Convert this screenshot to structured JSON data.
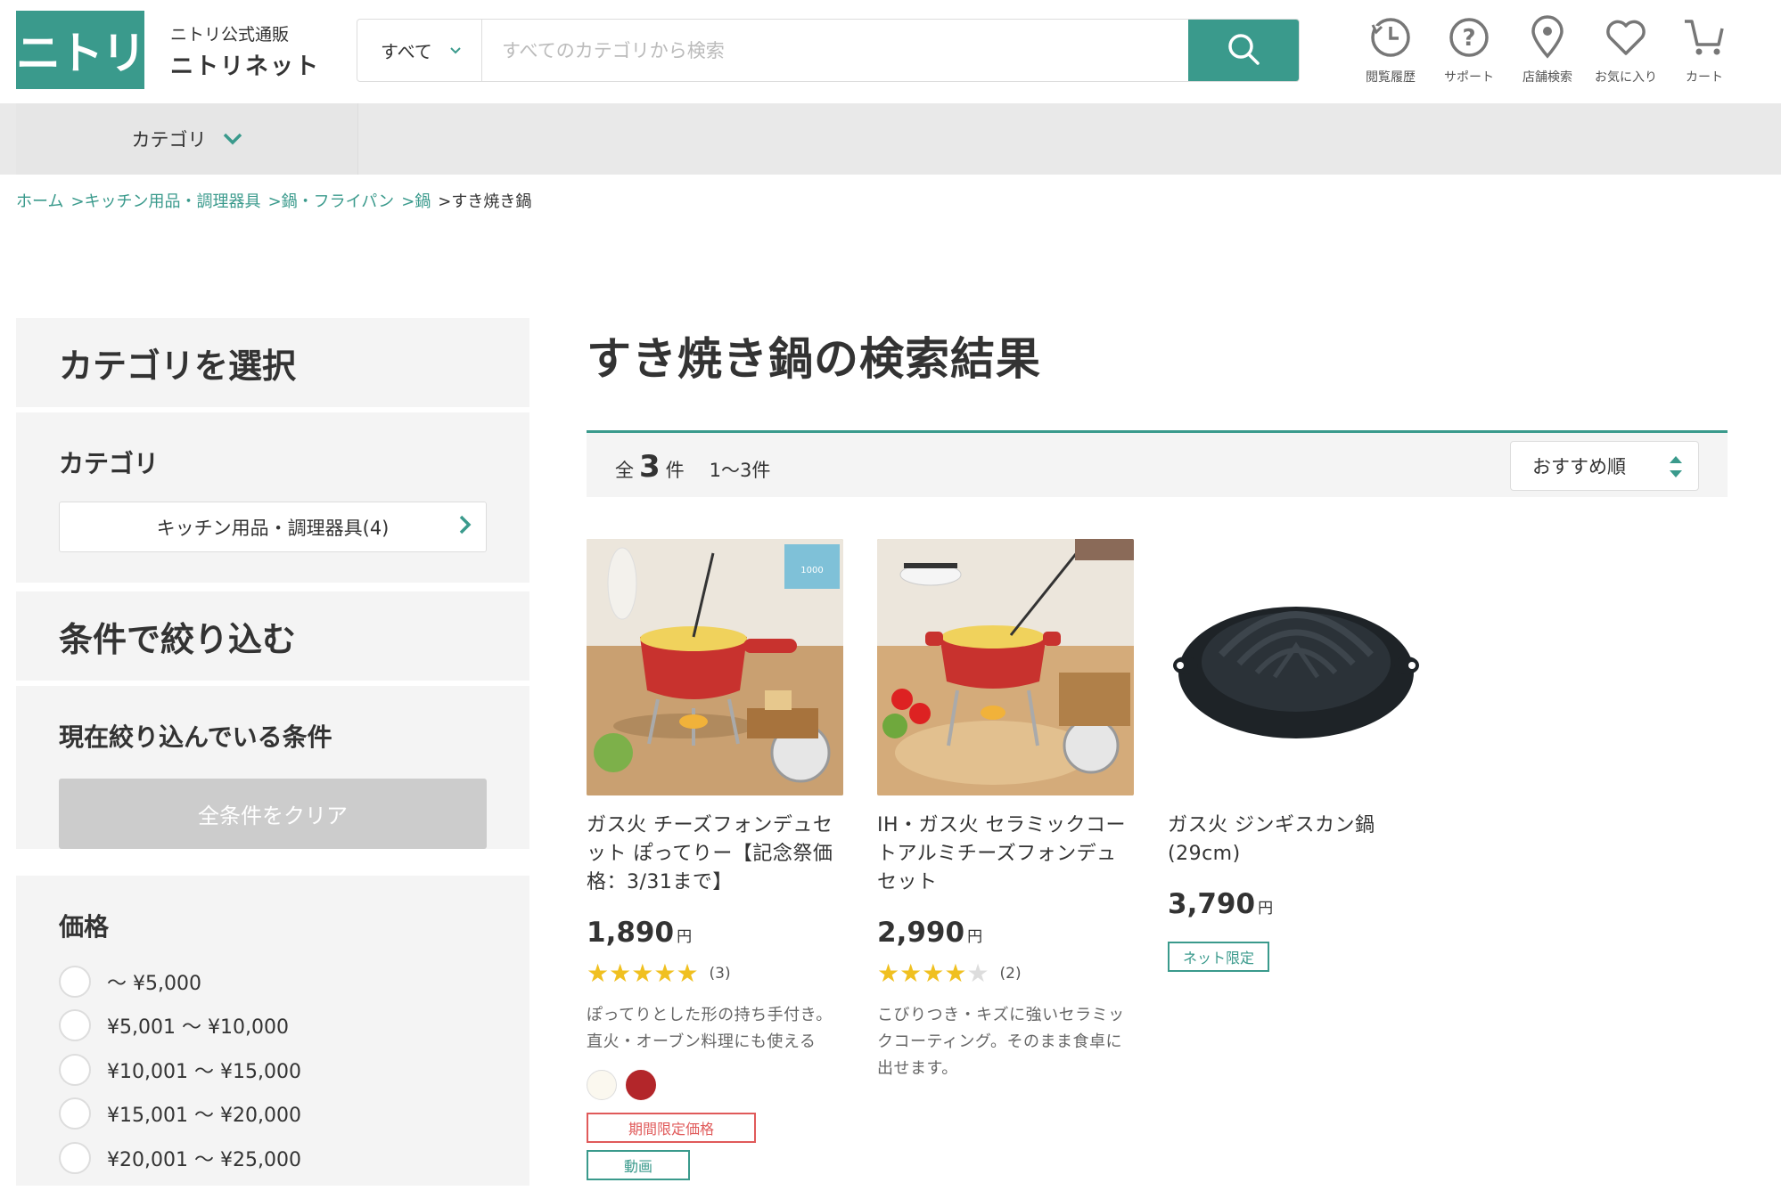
{
  "header": {
    "logo_text": "ニトリ",
    "brand_sub": "ニトリ公式通販",
    "brand_main": "ニトリネット",
    "search_category": "すべて",
    "search_placeholder": "すべてのカテゴリから検索",
    "icons": [
      {
        "label": "閲覧履歴",
        "icon": "history-icon"
      },
      {
        "label": "サポート",
        "icon": "help-icon"
      },
      {
        "label": "店舗検索",
        "icon": "location-pin-icon"
      },
      {
        "label": "お気に入り",
        "icon": "heart-icon"
      },
      {
        "label": "カート",
        "icon": "cart-icon"
      }
    ],
    "accent_color": "#3a9a8c"
  },
  "catbar": {
    "label": "カテゴリ"
  },
  "breadcrumb": [
    "ホーム",
    ">キッチン用品・調理器具",
    ">鍋・フライパン",
    ">鍋",
    ">すき焼き鍋"
  ],
  "sidebar": {
    "select_title": "カテゴリを選択",
    "category_heading": "カテゴリ",
    "category_item": "キッチン用品・調理器具(4)",
    "filter_title": "条件で絞り込む",
    "current_heading": "現在絞り込んでいる条件",
    "clear_label": "全条件をクリア",
    "price_heading": "価格",
    "prices": [
      "〜 ¥5,000",
      "¥5,001 〜 ¥10,000",
      "¥10,001 〜 ¥15,000",
      "¥15,001 〜 ¥20,000",
      "¥20,001 〜 ¥25,000"
    ]
  },
  "main": {
    "title": "すき焼き鍋の検索結果",
    "count_prefix": "全",
    "count": "3",
    "count_suffix": "件",
    "range": "1〜3件",
    "sort_label": "おすすめ順",
    "products": [
      {
        "name": "ガス火 チーズフォンデュセット ぽってりー【記念祭価格：3/31まで】",
        "price": "1,890",
        "yen": "円",
        "stars": 5,
        "review_count": "(3)",
        "desc": "ぽってりとした形の持ち手付き。直火・オーブン料理にも使える",
        "tag1": "期間限定価格",
        "tag2": "動画"
      },
      {
        "name": "IH・ガス火 セラミックコートアルミチーズフォンデュセット",
        "price": "2,990",
        "yen": "円",
        "stars": 4,
        "review_count": "(2)",
        "desc": "こびりつき・キズに強いセラミックコーティング。そのまま食卓に出せます。"
      },
      {
        "name": "ガス火 ジンギスカン鍋 (29cm)",
        "price": "3,790",
        "yen": "円",
        "tag": "ネット限定"
      }
    ]
  }
}
